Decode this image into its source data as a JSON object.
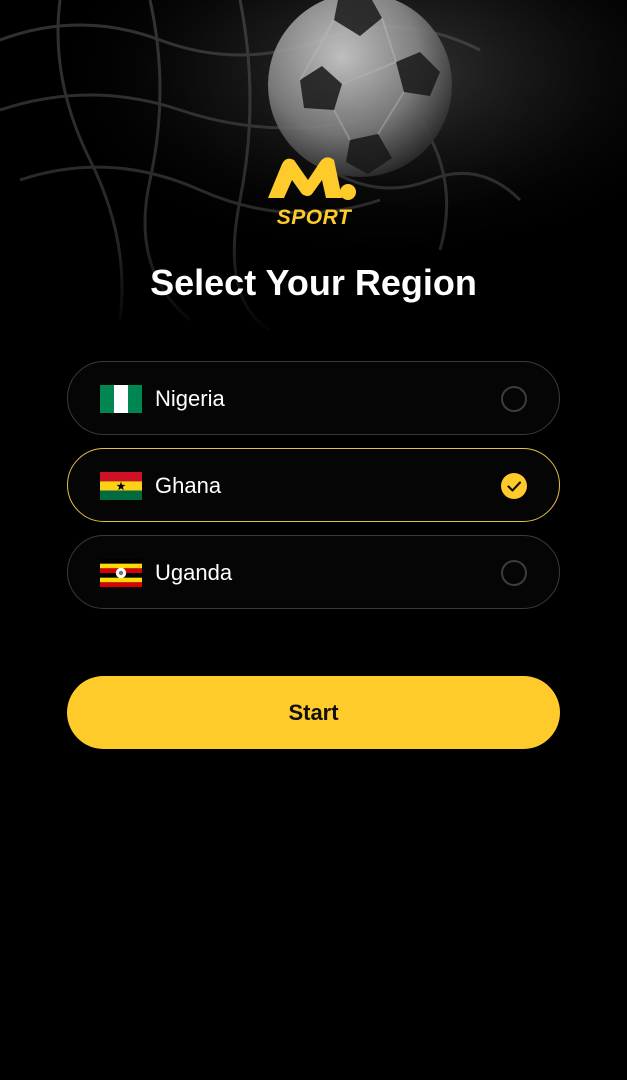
{
  "brand": {
    "logo_text": "SPORT",
    "accent_color": "#FFCB2B"
  },
  "page": {
    "title": "Select Your Region"
  },
  "regions": [
    {
      "label": "Nigeria",
      "flag": "nigeria-flag",
      "selected": false
    },
    {
      "label": "Ghana",
      "flag": "ghana-flag",
      "selected": true
    },
    {
      "label": "Uganda",
      "flag": "uganda-flag",
      "selected": false
    }
  ],
  "actions": {
    "start_label": "Start"
  },
  "colors": {
    "background": "#000000",
    "selected_border": "#E3BF45",
    "unselected_border": "#3A3A3A"
  }
}
